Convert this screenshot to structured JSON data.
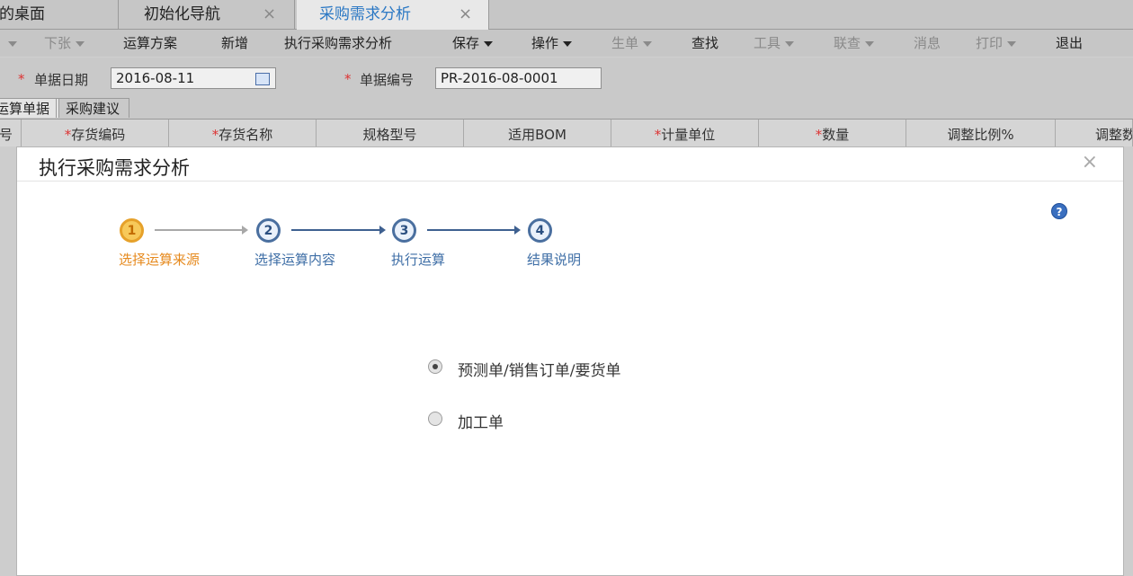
{
  "tabs": [
    {
      "label": "我的桌面",
      "active": false
    },
    {
      "label": "初始化导航",
      "active": false
    },
    {
      "label": "采购需求分析",
      "active": true
    }
  ],
  "toolbar": {
    "xiazhang": "下张",
    "yunsuan_fangan": "运算方案",
    "xinzeng": "新增",
    "zhixing": "执行采购需求分析",
    "baocun": "保存",
    "caozuo": "操作",
    "shengdan": "生单",
    "chazhao": "查找",
    "gongju": "工具",
    "liancha": "联查",
    "xiaoxi": "消息",
    "dayin": "打印",
    "tuichu": "退出"
  },
  "form": {
    "date_label": "单据日期",
    "date_value": "2016-08-11",
    "code_label": "单据编号",
    "code_value": "PR-2016-08-0001"
  },
  "subtabs": [
    "运算单据",
    "采购建议"
  ],
  "grid_headers": [
    {
      "label": "号",
      "required": false
    },
    {
      "label": "存货编码",
      "required": true
    },
    {
      "label": "存货名称",
      "required": true
    },
    {
      "label": "规格型号",
      "required": false
    },
    {
      "label": "适用BOM",
      "required": false
    },
    {
      "label": "计量单位",
      "required": true
    },
    {
      "label": "数量",
      "required": true
    },
    {
      "label": "调整比例%",
      "required": false
    },
    {
      "label": "调整数",
      "required": false
    }
  ],
  "modal": {
    "title": "执行采购需求分析",
    "close": "×",
    "help": "?",
    "steps": [
      {
        "num": "1",
        "label": "选择运算来源",
        "state": "active"
      },
      {
        "num": "2",
        "label": "选择运算内容",
        "state": "todo"
      },
      {
        "num": "3",
        "label": "执行运算",
        "state": "todo"
      },
      {
        "num": "4",
        "label": "结果说明",
        "state": "todo"
      }
    ],
    "options": [
      {
        "label": "预测单/销售订单/要货单",
        "checked": true
      },
      {
        "label": "加工单",
        "checked": false
      }
    ]
  },
  "colors": {
    "active_tab_text": "#2b78c4",
    "step_active": "#e68a1e",
    "step_todo": "#3e6ea6",
    "required_star": "#dd3333"
  }
}
